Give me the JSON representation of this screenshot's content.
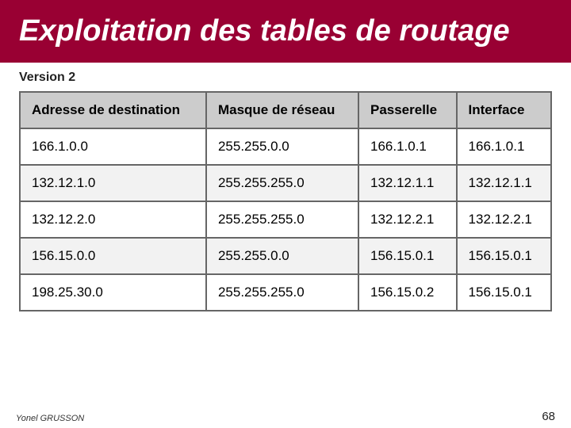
{
  "header": {
    "title": "Exploitation des tables de routage",
    "version": "Version 2"
  },
  "table": {
    "columns": [
      "Adresse de destination",
      "Masque de réseau",
      "Passerelle",
      "Interface"
    ],
    "rows": [
      [
        "166.1.0.0",
        "255.255.0.0",
        "166.1.0.1",
        "166.1.0.1"
      ],
      [
        "132.12.1.0",
        "255.255.255.0",
        "132.12.1.1",
        "132.12.1.1"
      ],
      [
        "132.12.2.0",
        "255.255.255.0",
        "132.12.2.1",
        "132.12.2.1"
      ],
      [
        "156.15.0.0",
        "255.255.0.0",
        "156.15.0.1",
        "156.15.0.1"
      ],
      [
        "198.25.30.0",
        "255.255.255.0",
        "156.15.0.2",
        "156.15.0.1"
      ]
    ]
  },
  "footer": {
    "author": "Yonel GRUSSON",
    "page": "68"
  }
}
